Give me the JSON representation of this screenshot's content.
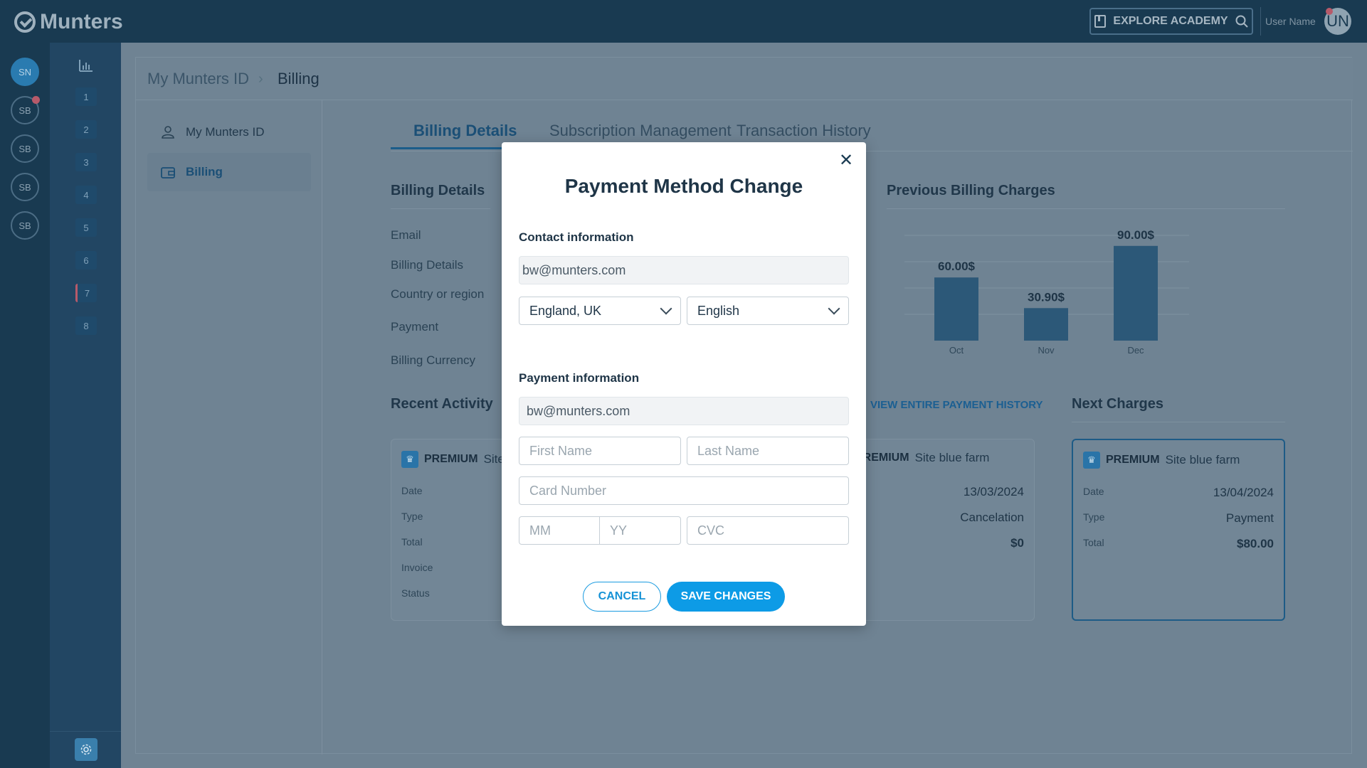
{
  "brand": {
    "name": "Munters"
  },
  "topbar": {
    "explore_label": "EXPLORE ACADEMY",
    "user_name": "User Name",
    "user_initials": "UN"
  },
  "sites": [
    "SN",
    "SB",
    "SB",
    "SB",
    "SB"
  ],
  "nav_numbers": [
    "1",
    "2",
    "3",
    "4",
    "5",
    "6",
    "7",
    "8"
  ],
  "breadcrumb": {
    "root": "My Munters ID",
    "current": "Billing"
  },
  "side_menu": [
    {
      "label": "My Munters ID",
      "icon": "person-icon"
    },
    {
      "label": "Billing",
      "icon": "wallet-icon"
    }
  ],
  "tabs": [
    "Billing Details",
    "Subscription Management",
    "Transaction History"
  ],
  "billing_details": {
    "title": "Billing Details",
    "fields": [
      "Email",
      "Billing Details",
      "Country or region",
      "Payment",
      "Billing Currency"
    ]
  },
  "previous_charges": {
    "title": "Previous Billing Charges"
  },
  "chart_data": {
    "type": "bar",
    "categories": [
      "Oct",
      "Nov",
      "Dec"
    ],
    "values": [
      60.0,
      30.9,
      90.0
    ],
    "value_labels": [
      "60.00$",
      "30.90$",
      "90.00$"
    ],
    "title": "Previous Billing Charges"
  },
  "recent_activity": {
    "title": "Recent Activity",
    "history_link": "VIEW ENTIRE PAYMENT HISTORY",
    "cards": [
      {
        "tier": "PREMIUM",
        "site": "Site",
        "labels": [
          "Date",
          "Type",
          "Total",
          "Invoice",
          "Status"
        ]
      },
      {
        "tier": "PREMIUM",
        "site": "Site blue farm",
        "date": "13/03/2024",
        "type": "Cancelation",
        "total": "$0"
      }
    ]
  },
  "next_charges": {
    "title": "Next Charges",
    "card": {
      "tier": "PREMIUM",
      "site": "Site blue farm",
      "labels": [
        "Date",
        "Type",
        "Total"
      ],
      "date": "13/04/2024",
      "type": "Payment",
      "total": "$80.00"
    }
  },
  "modal": {
    "title": "Payment Method Change",
    "contact_title": "Contact information",
    "contact_email": "bw@munters.com",
    "country": "England, UK",
    "language": "English",
    "payment_title": "Payment information",
    "payment_email": "bw@munters.com",
    "placeholders": {
      "first_name": "First Name",
      "last_name": "Last Name",
      "card_number": "Card Number",
      "mm": "MM",
      "yy": "YY",
      "cvc": "CVC"
    },
    "cancel_label": "CANCEL",
    "save_label": "SAVE CHANGES"
  },
  "colors": {
    "accent": "#0d9be6",
    "topbar": "#193a51",
    "overlay_bg": "#6f8393"
  }
}
